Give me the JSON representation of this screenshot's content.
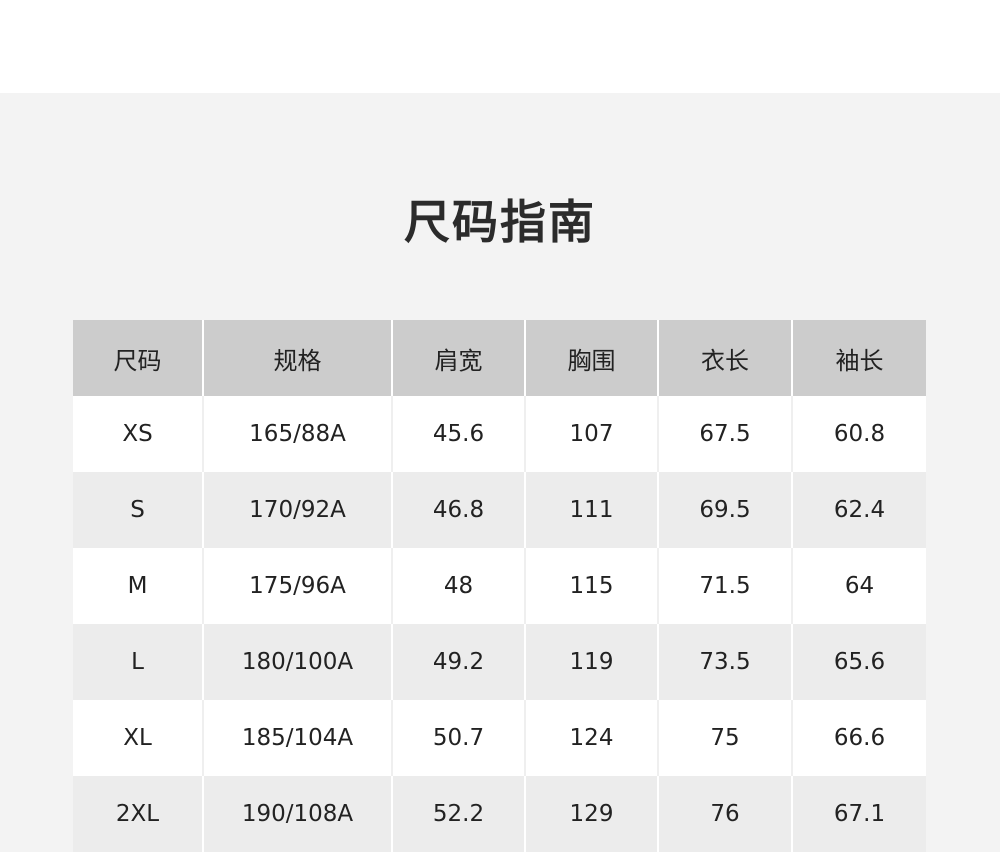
{
  "title": "尺码指南",
  "table": {
    "headers": [
      "尺码",
      "规格",
      "肩宽",
      "胸围",
      "衣长",
      "袖长"
    ],
    "rows": [
      [
        "XS",
        "165/88A",
        "45.6",
        "107",
        "67.5",
        "60.8"
      ],
      [
        "S",
        "170/92A",
        "46.8",
        "111",
        "69.5",
        "62.4"
      ],
      [
        "M",
        "175/96A",
        "48",
        "115",
        "71.5",
        "64"
      ],
      [
        "L",
        "180/100A",
        "49.2",
        "119",
        "73.5",
        "65.6"
      ],
      [
        "XL",
        "185/104A",
        "50.7",
        "124",
        "75",
        "66.6"
      ],
      [
        "2XL",
        "190/108A",
        "52.2",
        "129",
        "76",
        "67.1"
      ]
    ]
  },
  "colors": {
    "panel_background": "#f3f3f3",
    "header_background": "#cccccc",
    "row_alt_background": "#ececec",
    "row_background": "#ffffff",
    "text": "#222222"
  }
}
